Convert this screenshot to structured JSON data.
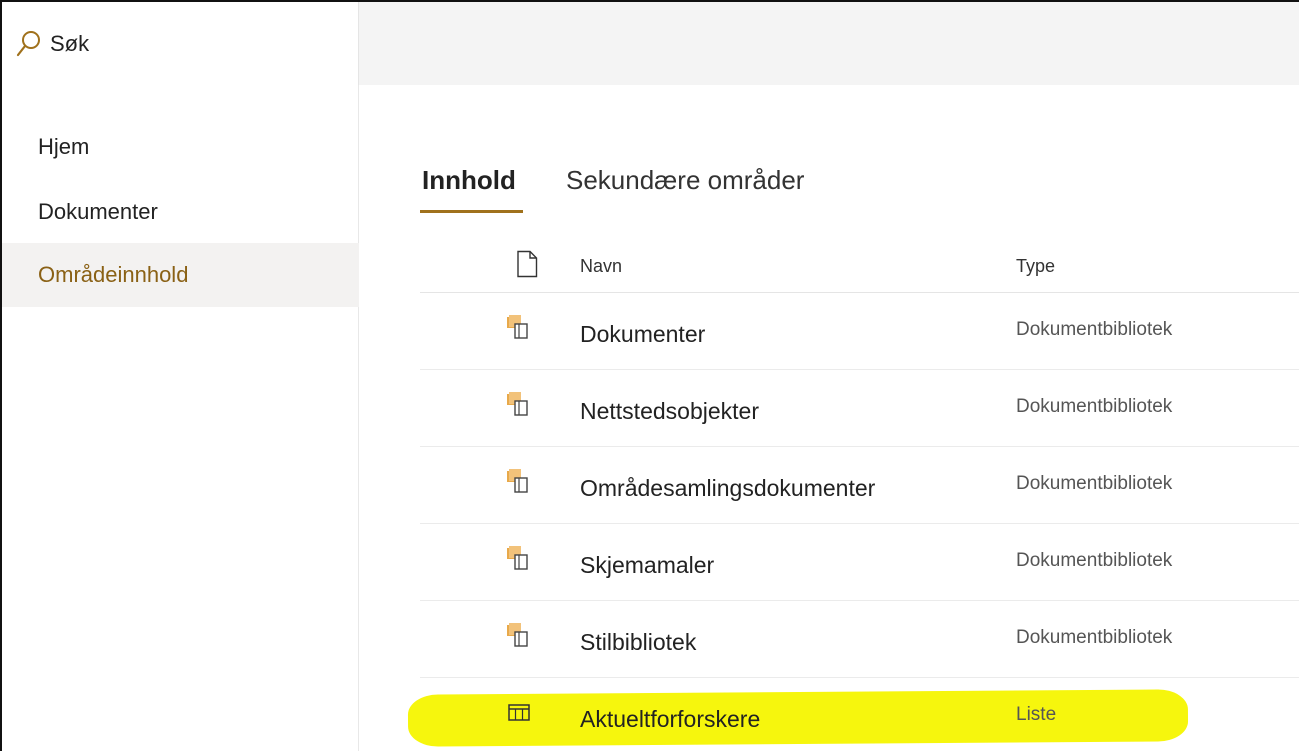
{
  "search": {
    "label": "Søk"
  },
  "sidebar": {
    "items": [
      {
        "label": "Hjem"
      },
      {
        "label": "Dokumenter"
      },
      {
        "label": "Områdeinnhold",
        "selected": true
      }
    ]
  },
  "tabs": [
    {
      "label": "Innhold",
      "active": true
    },
    {
      "label": "Sekundære områder"
    }
  ],
  "table": {
    "columns": {
      "name": "Navn",
      "type": "Type"
    },
    "rows": [
      {
        "name": "Dokumenter",
        "type": "Dokumentbibliotek",
        "icon": "document-library-icon"
      },
      {
        "name": "Nettstedsobjekter",
        "type": "Dokumentbibliotek",
        "icon": "document-library-icon"
      },
      {
        "name": "Områdesamlingsdokumenter",
        "type": "Dokumentbibliotek",
        "icon": "document-library-icon"
      },
      {
        "name": "Skjemamaler",
        "type": "Dokumentbibliotek",
        "icon": "document-library-icon"
      },
      {
        "name": "Stilbibliotek",
        "type": "Dokumentbibliotek",
        "icon": "document-library-icon"
      },
      {
        "name": "Aktueltforforskere",
        "type": "Liste",
        "icon": "list-icon",
        "highlighted": true
      }
    ]
  },
  "colors": {
    "accent": "#a0711c",
    "selected_text": "#8a6115",
    "highlight": "#f5f500"
  }
}
